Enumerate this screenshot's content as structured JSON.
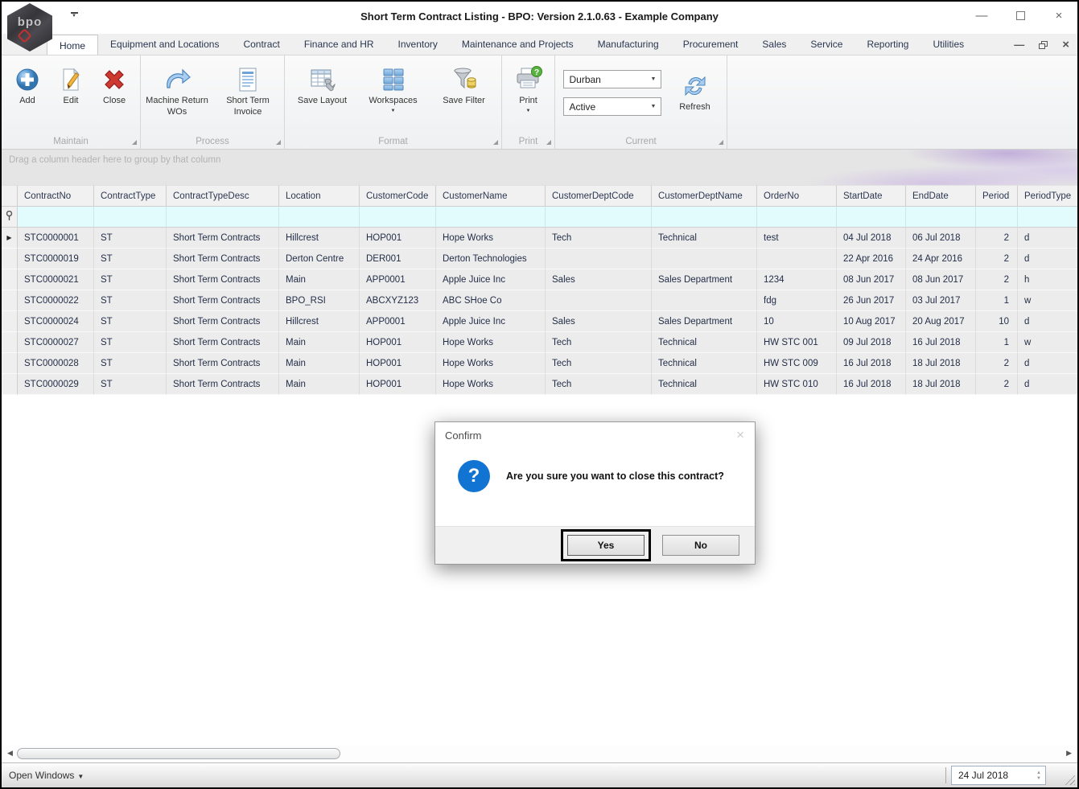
{
  "window": {
    "title": "Short Term Contract Listing - BPO: Version 2.1.0.63 - Example Company",
    "logo_text": "bpo"
  },
  "tabs": {
    "active": "Home",
    "items": [
      "Home",
      "Equipment and Locations",
      "Contract",
      "Finance and HR",
      "Inventory",
      "Maintenance and Projects",
      "Manufacturing",
      "Procurement",
      "Sales",
      "Service",
      "Reporting",
      "Utilities"
    ]
  },
  "ribbon": {
    "maintain": {
      "label": "Maintain",
      "add": "Add",
      "edit": "Edit",
      "close": "Close"
    },
    "process": {
      "label": "Process",
      "machine_return": "Machine Return WOs",
      "short_term_invoice": "Short Term Invoice"
    },
    "format": {
      "label": "Format",
      "save_layout": "Save Layout",
      "workspaces": "Workspaces",
      "save_filter": "Save Filter"
    },
    "print": {
      "label": "Print",
      "print_button": "Print"
    },
    "current": {
      "label": "Current",
      "site": "Durban",
      "status": "Active",
      "refresh": "Refresh"
    }
  },
  "grid": {
    "group_hint": "Drag a column header here to group by that column",
    "columns": [
      "ContractNo",
      "ContractType",
      "ContractTypeDesc",
      "Location",
      "CustomerCode",
      "CustomerName",
      "CustomerDeptCode",
      "CustomerDeptName",
      "OrderNo",
      "StartDate",
      "EndDate",
      "Period",
      "PeriodType"
    ],
    "rows": [
      [
        "STC0000001",
        "ST",
        "Short Term Contracts",
        "Hillcrest",
        "HOP001",
        "Hope Works",
        "Tech",
        "Technical",
        "test",
        "04 Jul 2018",
        "06 Jul 2018",
        "2",
        "d"
      ],
      [
        "STC0000019",
        "ST",
        "Short Term Contracts",
        "Derton Centre",
        "DER001",
        "Derton Technologies",
        "",
        "",
        "",
        "22 Apr 2016",
        "24 Apr 2016",
        "2",
        "d"
      ],
      [
        "STC0000021",
        "ST",
        "Short Term Contracts",
        "Main",
        "APP0001",
        "Apple Juice Inc",
        "Sales",
        "Sales Department",
        "1234",
        "08 Jun 2017",
        "08 Jun 2017",
        "2",
        "h"
      ],
      [
        "STC0000022",
        "ST",
        "Short Term Contracts",
        "BPO_RSI",
        "ABCXYZ123",
        "ABC SHoe Co",
        "",
        "",
        "fdg",
        "26 Jun 2017",
        "03 Jul 2017",
        "1",
        "w"
      ],
      [
        "STC0000024",
        "ST",
        "Short Term Contracts",
        "Hillcrest",
        "APP0001",
        "Apple Juice Inc",
        "Sales",
        "Sales Department",
        "10",
        "10 Aug 2017",
        "20 Aug 2017",
        "10",
        "d"
      ],
      [
        "STC0000027",
        "ST",
        "Short Term Contracts",
        "Main",
        "HOP001",
        "Hope Works",
        "Tech",
        "Technical",
        "HW STC 001",
        "09 Jul 2018",
        "16 Jul 2018",
        "1",
        "w"
      ],
      [
        "STC0000028",
        "ST",
        "Short Term Contracts",
        "Main",
        "HOP001",
        "Hope Works",
        "Tech",
        "Technical",
        "HW STC 009",
        "16 Jul 2018",
        "18 Jul 2018",
        "2",
        "d"
      ],
      [
        "STC0000029",
        "ST",
        "Short Term Contracts",
        "Main",
        "HOP001",
        "Hope Works",
        "Tech",
        "Technical",
        "HW STC 010",
        "16 Jul 2018",
        "18 Jul 2018",
        "2",
        "d"
      ]
    ]
  },
  "dialog": {
    "title": "Confirm",
    "message": "Are you sure you want to close this contract?",
    "yes_label": "Yes",
    "no_label": "No"
  },
  "statusbar": {
    "open_windows": "Open Windows",
    "date": "24 Jul 2018"
  },
  "colors": {
    "dialog_icon_blue": "#1274d2",
    "close_red": "#c9302c",
    "filter_row_cyan": "#e2fbfc",
    "swoosh_purple": "#c4aae4",
    "icon_blue": "#5b9bd5"
  }
}
